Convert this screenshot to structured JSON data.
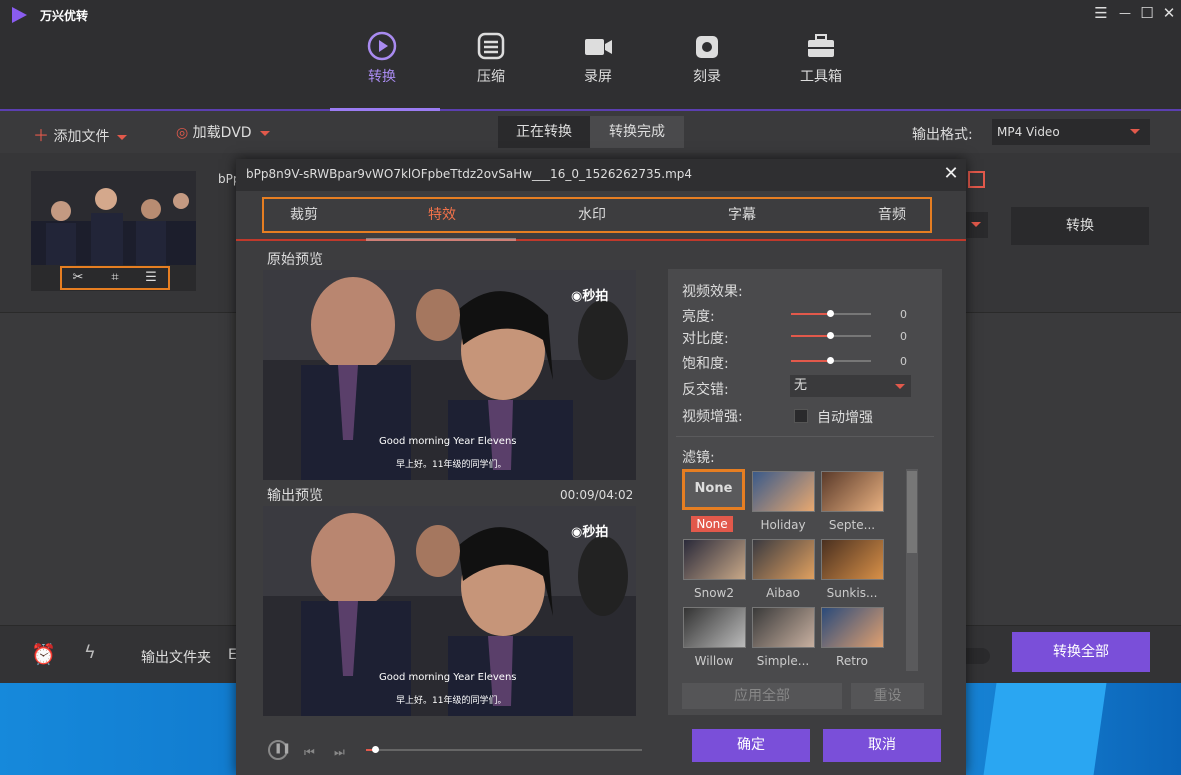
{
  "app": {
    "name": "万兴优转"
  },
  "window": {
    "minimize": "☰",
    "min": "—",
    "max": "☐",
    "close": "✕"
  },
  "nav": [
    {
      "label": "转换",
      "icon": "play-circle-icon",
      "active": true
    },
    {
      "label": "压缩",
      "icon": "compress-icon"
    },
    {
      "label": "录屏",
      "icon": "camera-icon"
    },
    {
      "label": "刻录",
      "icon": "disc-icon"
    },
    {
      "label": "工具箱",
      "icon": "toolbox-icon"
    }
  ],
  "toolbar": {
    "add_file": "添加文件",
    "load_dvd": "加载DVD",
    "seg_converting": "正在转换",
    "seg_done": "转换完成",
    "output_format_label": "输出格式:",
    "output_format_value": "MP4 Video"
  },
  "file": {
    "name_prefix": "bPp",
    "convert": "转换"
  },
  "bottom": {
    "output_folder": "输出文件夹",
    "folder_prefix": "E",
    "convert_all": "转换全部"
  },
  "dialog": {
    "title": "bPp8n9V-sRWBpar9vWO7klOFpbeTtdz2ovSaHw___16_0_1526262735.mp4",
    "close": "✕",
    "tabs": [
      "裁剪",
      "特效",
      "水印",
      "字幕",
      "音频"
    ],
    "active_tab": "特效",
    "original_preview": "原始预览",
    "output_preview": "输出预览",
    "time": "00:09/04:02",
    "watermark": "◉秒拍",
    "subtitle_en": "Good morning Year Elevens",
    "subtitle_cn": "早上好。11年级的同学们。",
    "effects": {
      "heading": "视频效果:",
      "brightness": "亮度:",
      "contrast": "对比度:",
      "saturation": "饱和度:",
      "brightness_val": "0",
      "contrast_val": "0",
      "saturation_val": "0",
      "deinterlace": "反交错:",
      "deinterlace_val": "无",
      "enhance": "视频增强:",
      "auto_enhance": "自动增强"
    },
    "filters_label": "滤镜:",
    "filters": [
      "None",
      "Holiday",
      "Septe...",
      "Snow2",
      "Aibao",
      "Sunkis...",
      "Willow",
      "Simple...",
      "Retro"
    ],
    "selected_filter": "None",
    "apply_all": "应用全部",
    "reset": "重设",
    "ok": "确定",
    "cancel": "取消"
  },
  "colors": {
    "accent": "#7a4fd9",
    "highlight": "#e67e22",
    "red": "#e2594b"
  }
}
